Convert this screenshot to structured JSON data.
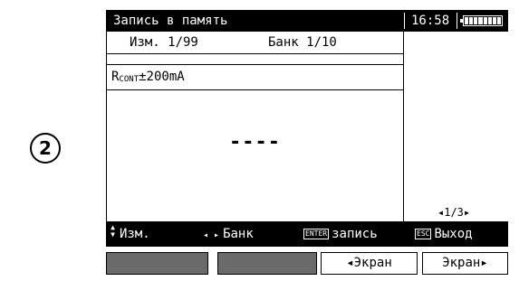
{
  "step_label": "2",
  "header": {
    "title": "Запись в память",
    "time": "16:58"
  },
  "record": {
    "measurement": "Изм. 1/99",
    "bank": "Банк 1/10"
  },
  "function": {
    "symbol": "R",
    "subscript": "CONT",
    "value": "±200mA"
  },
  "result": {
    "value": "----"
  },
  "page_indicator": "◂1/3▸",
  "hints": {
    "meas_label": "Изм.",
    "bank_arrows": "◂ ▸",
    "bank_label": "Банк",
    "enter_key": "ENTER",
    "enter_label": "запись",
    "esc_key": "ESC",
    "esc_label": "Выход"
  },
  "softkeys": {
    "key1": "",
    "key2": "",
    "key3": "◂Экран",
    "key4": "Экран▸"
  },
  "colors": {
    "bar_bg": "#000000",
    "blank_softkey": "#6a6a6a"
  }
}
